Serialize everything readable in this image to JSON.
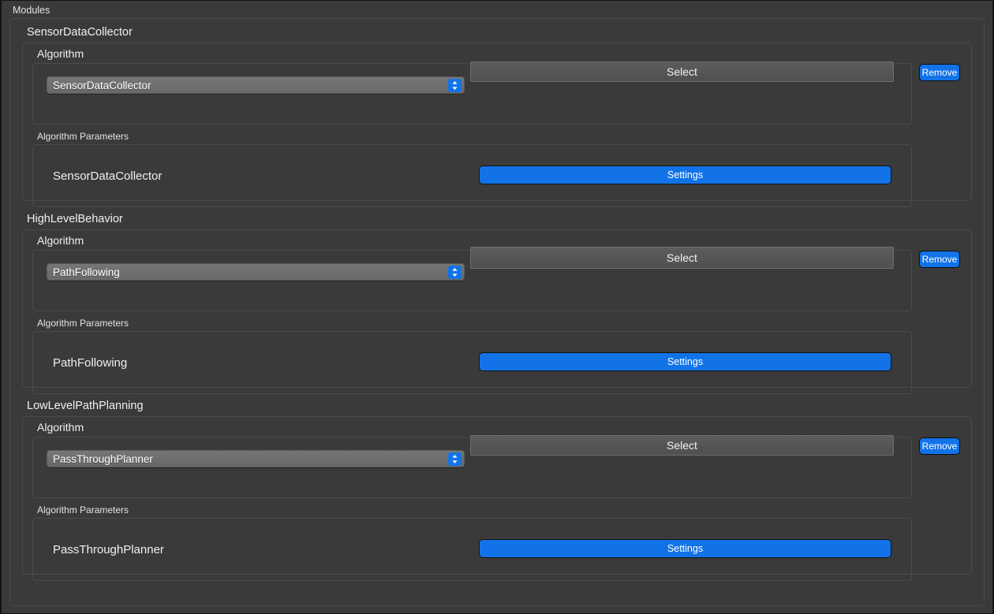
{
  "window": {
    "group_title": "Modules"
  },
  "labels": {
    "algorithm_group": "Algorithm",
    "algorithm_parameters_group": "Algorithm Parameters",
    "select_button": "Select",
    "remove_button": "Remove",
    "settings_button": "Settings",
    "dropdown_icon": "chevron-up-down-icon"
  },
  "colors": {
    "accent_blue": "#1273e8",
    "window_bg": "#3a3a3a",
    "frame_border": "#4a4a4a",
    "combo_bg": "#6f6f6f",
    "select_btn_bg": "#565656",
    "text": "#f0f0f0"
  },
  "modules": [
    {
      "title": "SensorDataCollector",
      "algorithm": {
        "selected": "SensorDataCollector",
        "select_label": "Select",
        "remove_label": "Remove"
      },
      "parameters": {
        "name": "SensorDataCollector",
        "settings_label": "Settings"
      }
    },
    {
      "title": "HighLevelBehavior",
      "algorithm": {
        "selected": "PathFollowing",
        "select_label": "Select",
        "remove_label": "Remove"
      },
      "parameters": {
        "name": "PathFollowing",
        "settings_label": "Settings"
      }
    },
    {
      "title": "LowLevelPathPlanning",
      "algorithm": {
        "selected": "PassThroughPlanner",
        "select_label": "Select",
        "remove_label": "Remove"
      },
      "parameters": {
        "name": "PassThroughPlanner",
        "settings_label": "Settings"
      }
    }
  ]
}
